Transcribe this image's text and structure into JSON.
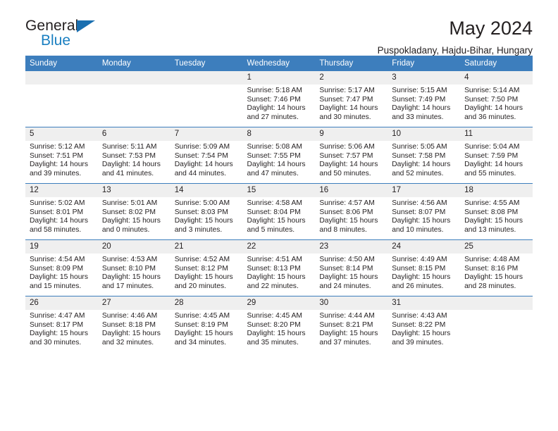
{
  "brand": {
    "name_part1": "General",
    "name_part2": "Blue",
    "triangle_color": "#1a6fb0",
    "blue_color": "#1a7fc1"
  },
  "header": {
    "title": "May 2024",
    "subtitle": "Puspokladany, Hajdu-Bihar, Hungary"
  },
  "theme": {
    "header_row_bg": "#3d7ebd",
    "daynum_bg": "#efefef",
    "text_color": "#231f20"
  },
  "weekday_headers": [
    "Sunday",
    "Monday",
    "Tuesday",
    "Wednesday",
    "Thursday",
    "Friday",
    "Saturday"
  ],
  "weeks": [
    [
      {
        "day": "",
        "empty": true,
        "sunrise": "",
        "sunset": "",
        "daylight_line1": "",
        "daylight_line2": ""
      },
      {
        "day": "",
        "empty": true,
        "sunrise": "",
        "sunset": "",
        "daylight_line1": "",
        "daylight_line2": ""
      },
      {
        "day": "",
        "empty": true,
        "sunrise": "",
        "sunset": "",
        "daylight_line1": "",
        "daylight_line2": ""
      },
      {
        "day": "1",
        "empty": false,
        "sunrise": "Sunrise: 5:18 AM",
        "sunset": "Sunset: 7:46 PM",
        "daylight_line1": "Daylight: 14 hours",
        "daylight_line2": "and 27 minutes."
      },
      {
        "day": "2",
        "empty": false,
        "sunrise": "Sunrise: 5:17 AM",
        "sunset": "Sunset: 7:47 PM",
        "daylight_line1": "Daylight: 14 hours",
        "daylight_line2": "and 30 minutes."
      },
      {
        "day": "3",
        "empty": false,
        "sunrise": "Sunrise: 5:15 AM",
        "sunset": "Sunset: 7:49 PM",
        "daylight_line1": "Daylight: 14 hours",
        "daylight_line2": "and 33 minutes."
      },
      {
        "day": "4",
        "empty": false,
        "sunrise": "Sunrise: 5:14 AM",
        "sunset": "Sunset: 7:50 PM",
        "daylight_line1": "Daylight: 14 hours",
        "daylight_line2": "and 36 minutes."
      }
    ],
    [
      {
        "day": "5",
        "empty": false,
        "sunrise": "Sunrise: 5:12 AM",
        "sunset": "Sunset: 7:51 PM",
        "daylight_line1": "Daylight: 14 hours",
        "daylight_line2": "and 39 minutes."
      },
      {
        "day": "6",
        "empty": false,
        "sunrise": "Sunrise: 5:11 AM",
        "sunset": "Sunset: 7:53 PM",
        "daylight_line1": "Daylight: 14 hours",
        "daylight_line2": "and 41 minutes."
      },
      {
        "day": "7",
        "empty": false,
        "sunrise": "Sunrise: 5:09 AM",
        "sunset": "Sunset: 7:54 PM",
        "daylight_line1": "Daylight: 14 hours",
        "daylight_line2": "and 44 minutes."
      },
      {
        "day": "8",
        "empty": false,
        "sunrise": "Sunrise: 5:08 AM",
        "sunset": "Sunset: 7:55 PM",
        "daylight_line1": "Daylight: 14 hours",
        "daylight_line2": "and 47 minutes."
      },
      {
        "day": "9",
        "empty": false,
        "sunrise": "Sunrise: 5:06 AM",
        "sunset": "Sunset: 7:57 PM",
        "daylight_line1": "Daylight: 14 hours",
        "daylight_line2": "and 50 minutes."
      },
      {
        "day": "10",
        "empty": false,
        "sunrise": "Sunrise: 5:05 AM",
        "sunset": "Sunset: 7:58 PM",
        "daylight_line1": "Daylight: 14 hours",
        "daylight_line2": "and 52 minutes."
      },
      {
        "day": "11",
        "empty": false,
        "sunrise": "Sunrise: 5:04 AM",
        "sunset": "Sunset: 7:59 PM",
        "daylight_line1": "Daylight: 14 hours",
        "daylight_line2": "and 55 minutes."
      }
    ],
    [
      {
        "day": "12",
        "empty": false,
        "sunrise": "Sunrise: 5:02 AM",
        "sunset": "Sunset: 8:01 PM",
        "daylight_line1": "Daylight: 14 hours",
        "daylight_line2": "and 58 minutes."
      },
      {
        "day": "13",
        "empty": false,
        "sunrise": "Sunrise: 5:01 AM",
        "sunset": "Sunset: 8:02 PM",
        "daylight_line1": "Daylight: 15 hours",
        "daylight_line2": "and 0 minutes."
      },
      {
        "day": "14",
        "empty": false,
        "sunrise": "Sunrise: 5:00 AM",
        "sunset": "Sunset: 8:03 PM",
        "daylight_line1": "Daylight: 15 hours",
        "daylight_line2": "and 3 minutes."
      },
      {
        "day": "15",
        "empty": false,
        "sunrise": "Sunrise: 4:58 AM",
        "sunset": "Sunset: 8:04 PM",
        "daylight_line1": "Daylight: 15 hours",
        "daylight_line2": "and 5 minutes."
      },
      {
        "day": "16",
        "empty": false,
        "sunrise": "Sunrise: 4:57 AM",
        "sunset": "Sunset: 8:06 PM",
        "daylight_line1": "Daylight: 15 hours",
        "daylight_line2": "and 8 minutes."
      },
      {
        "day": "17",
        "empty": false,
        "sunrise": "Sunrise: 4:56 AM",
        "sunset": "Sunset: 8:07 PM",
        "daylight_line1": "Daylight: 15 hours",
        "daylight_line2": "and 10 minutes."
      },
      {
        "day": "18",
        "empty": false,
        "sunrise": "Sunrise: 4:55 AM",
        "sunset": "Sunset: 8:08 PM",
        "daylight_line1": "Daylight: 15 hours",
        "daylight_line2": "and 13 minutes."
      }
    ],
    [
      {
        "day": "19",
        "empty": false,
        "sunrise": "Sunrise: 4:54 AM",
        "sunset": "Sunset: 8:09 PM",
        "daylight_line1": "Daylight: 15 hours",
        "daylight_line2": "and 15 minutes."
      },
      {
        "day": "20",
        "empty": false,
        "sunrise": "Sunrise: 4:53 AM",
        "sunset": "Sunset: 8:10 PM",
        "daylight_line1": "Daylight: 15 hours",
        "daylight_line2": "and 17 minutes."
      },
      {
        "day": "21",
        "empty": false,
        "sunrise": "Sunrise: 4:52 AM",
        "sunset": "Sunset: 8:12 PM",
        "daylight_line1": "Daylight: 15 hours",
        "daylight_line2": "and 20 minutes."
      },
      {
        "day": "22",
        "empty": false,
        "sunrise": "Sunrise: 4:51 AM",
        "sunset": "Sunset: 8:13 PM",
        "daylight_line1": "Daylight: 15 hours",
        "daylight_line2": "and 22 minutes."
      },
      {
        "day": "23",
        "empty": false,
        "sunrise": "Sunrise: 4:50 AM",
        "sunset": "Sunset: 8:14 PM",
        "daylight_line1": "Daylight: 15 hours",
        "daylight_line2": "and 24 minutes."
      },
      {
        "day": "24",
        "empty": false,
        "sunrise": "Sunrise: 4:49 AM",
        "sunset": "Sunset: 8:15 PM",
        "daylight_line1": "Daylight: 15 hours",
        "daylight_line2": "and 26 minutes."
      },
      {
        "day": "25",
        "empty": false,
        "sunrise": "Sunrise: 4:48 AM",
        "sunset": "Sunset: 8:16 PM",
        "daylight_line1": "Daylight: 15 hours",
        "daylight_line2": "and 28 minutes."
      }
    ],
    [
      {
        "day": "26",
        "empty": false,
        "sunrise": "Sunrise: 4:47 AM",
        "sunset": "Sunset: 8:17 PM",
        "daylight_line1": "Daylight: 15 hours",
        "daylight_line2": "and 30 minutes."
      },
      {
        "day": "27",
        "empty": false,
        "sunrise": "Sunrise: 4:46 AM",
        "sunset": "Sunset: 8:18 PM",
        "daylight_line1": "Daylight: 15 hours",
        "daylight_line2": "and 32 minutes."
      },
      {
        "day": "28",
        "empty": false,
        "sunrise": "Sunrise: 4:45 AM",
        "sunset": "Sunset: 8:19 PM",
        "daylight_line1": "Daylight: 15 hours",
        "daylight_line2": "and 34 minutes."
      },
      {
        "day": "29",
        "empty": false,
        "sunrise": "Sunrise: 4:45 AM",
        "sunset": "Sunset: 8:20 PM",
        "daylight_line1": "Daylight: 15 hours",
        "daylight_line2": "and 35 minutes."
      },
      {
        "day": "30",
        "empty": false,
        "sunrise": "Sunrise: 4:44 AM",
        "sunset": "Sunset: 8:21 PM",
        "daylight_line1": "Daylight: 15 hours",
        "daylight_line2": "and 37 minutes."
      },
      {
        "day": "31",
        "empty": false,
        "sunrise": "Sunrise: 4:43 AM",
        "sunset": "Sunset: 8:22 PM",
        "daylight_line1": "Daylight: 15 hours",
        "daylight_line2": "and 39 minutes."
      },
      {
        "day": "",
        "empty": true,
        "sunrise": "",
        "sunset": "",
        "daylight_line1": "",
        "daylight_line2": ""
      }
    ]
  ]
}
